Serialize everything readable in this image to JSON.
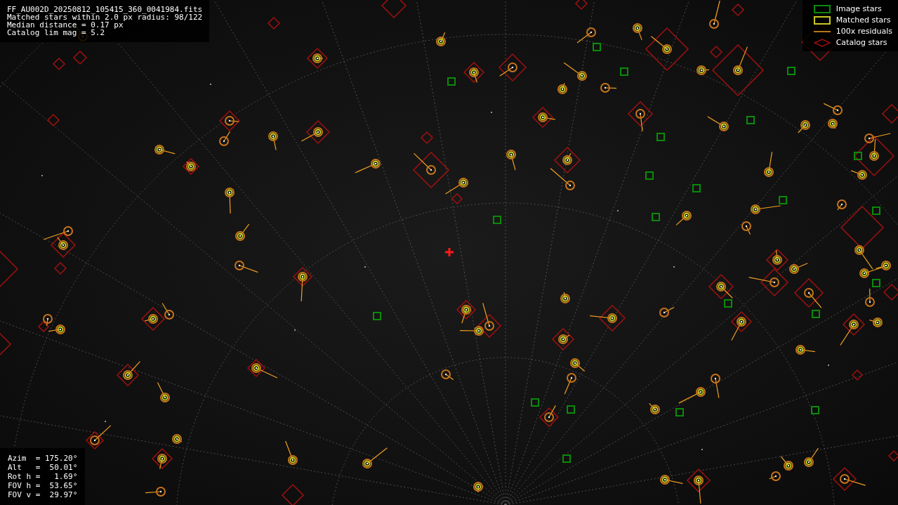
{
  "file_info": [
    "FF_AU002D_20250812_105415_360_0041984.fits",
    "Matched stars within 2.0 px radius: 98/122",
    "Median distance = 0.17 px",
    "Catalog lim mag = 5.2"
  ],
  "legend": [
    {
      "kind": "image",
      "label": "Image stars"
    },
    {
      "kind": "matched",
      "label": "Matched stars"
    },
    {
      "kind": "residual",
      "label": "100x residuals"
    },
    {
      "kind": "catalog",
      "label": "Catalog stars"
    }
  ],
  "pointing": [
    "Azim  = 175.20°",
    "Alt   =  50.01°",
    "Rot h =   1.69°",
    "FOV h =  53.65°",
    "FOV v =  29.97°"
  ]
}
